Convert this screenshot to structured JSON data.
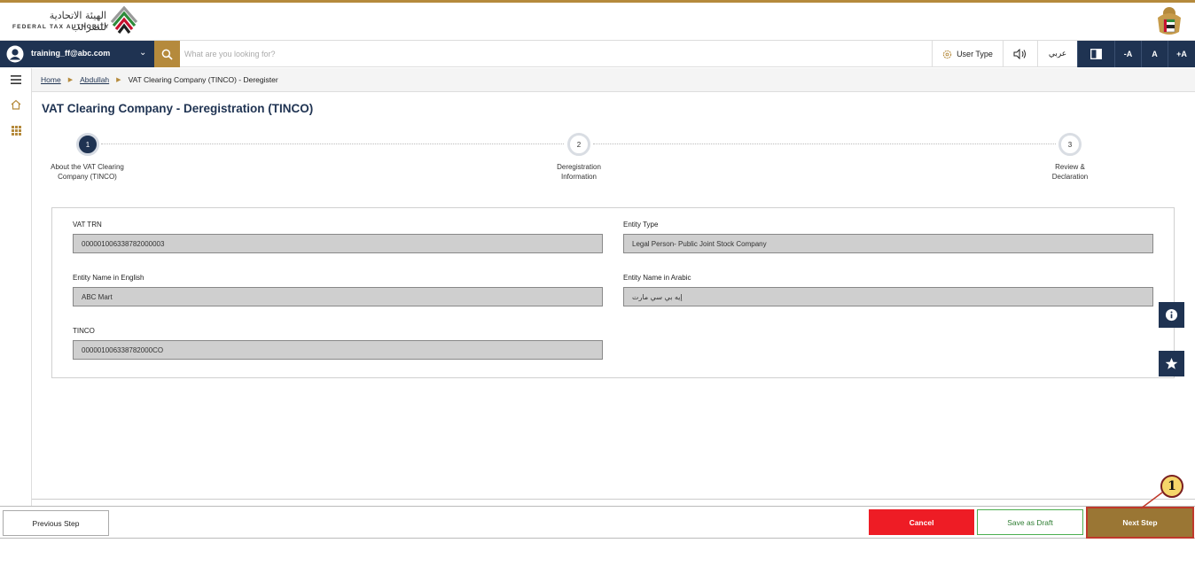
{
  "header": {
    "org_name_ar": "الهيئة الاتحادية للضرائب",
    "org_name_en": "FEDERAL TAX AUTHORITY",
    "accent_color": "#b58a3c",
    "brand_color": "#1f3352"
  },
  "toolbar": {
    "user_email": "training_ff@abc.com",
    "search_placeholder": "What are you looking for?",
    "user_type_label": "User Type",
    "language_label": "عربي",
    "font_decrease": "-A",
    "font_normal": "A",
    "font_increase": "+A"
  },
  "breadcrumb": {
    "home": "Home",
    "user": "Abdullah",
    "current": "VAT Clearing Company (TINCO) - Deregister"
  },
  "page": {
    "title": "VAT Clearing Company - Deregistration (TINCO)"
  },
  "steps": [
    {
      "number": "1",
      "label": "About the VAT Clearing Company (TINCO)",
      "active": true
    },
    {
      "number": "2",
      "label": "Deregistration Information",
      "active": false
    },
    {
      "number": "3",
      "label": "Review & Declaration",
      "active": false
    }
  ],
  "form": {
    "vat_trn_label": "VAT TRN",
    "vat_trn_value": "000001006338782000003",
    "entity_type_label": "Entity Type",
    "entity_type_value": "Legal Person- Public Joint Stock Company",
    "entity_name_en_label": "Entity Name in English",
    "entity_name_en_value": "ABC Mart",
    "entity_name_ar_label": "Entity Name in Arabic",
    "entity_name_ar_value": "إيه بي سي مارت",
    "tinco_label": "TINCO",
    "tinco_value": "000001006338782000CO"
  },
  "footer": {
    "previous_label": "Previous Step",
    "cancel_label": "Cancel",
    "draft_label": "Save as Draft",
    "next_label": "Next Step"
  },
  "annotation": {
    "marker": "1"
  },
  "icons": [
    "ftc-logo-icon",
    "uae-emblem-icon",
    "user-avatar-icon",
    "chevron-down-icon",
    "search-icon",
    "gear-icon",
    "speaker-icon",
    "contrast-icon",
    "menu-icon",
    "home-icon",
    "grid-icon",
    "info-icon",
    "star-icon"
  ]
}
